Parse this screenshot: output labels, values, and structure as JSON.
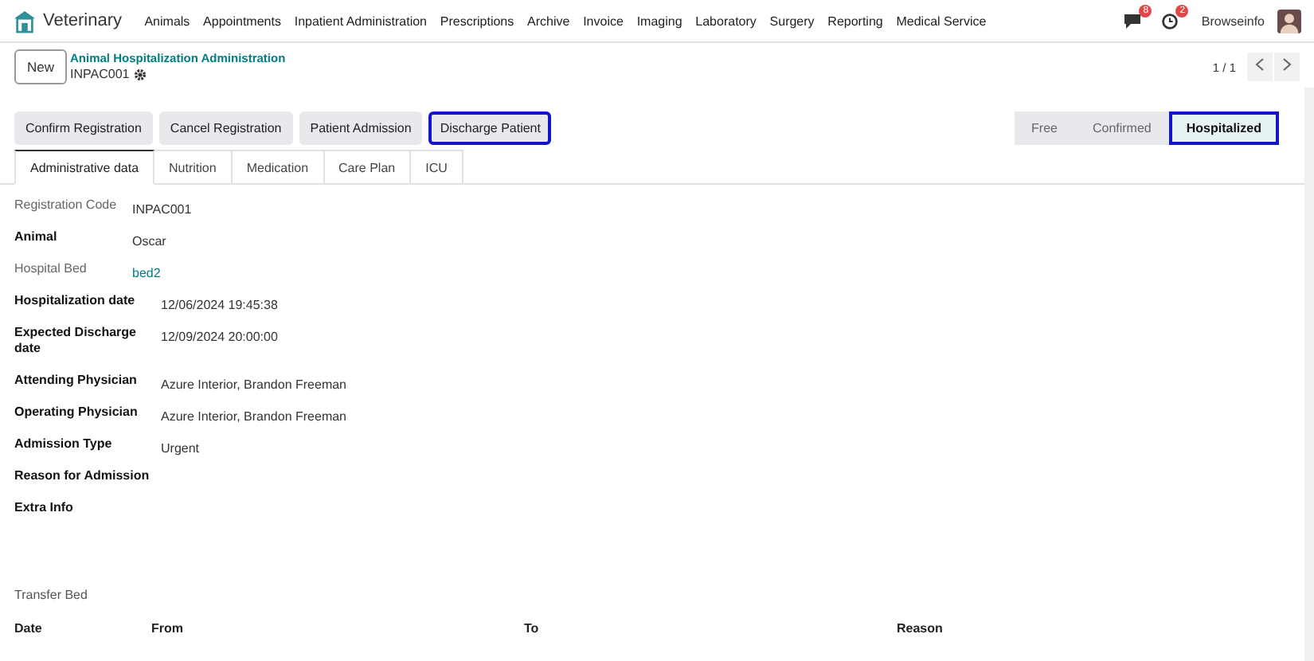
{
  "navbar": {
    "app_name": "Veterinary",
    "menu": [
      "Animals",
      "Appointments",
      "Inpatient Administration",
      "Prescriptions",
      "Archive",
      "Invoice",
      "Imaging",
      "Laboratory",
      "Surgery",
      "Reporting",
      "Medical Service"
    ],
    "messages_badge": "8",
    "activities_badge": "2",
    "user": "Browseinfo"
  },
  "control_panel": {
    "new_button": "New",
    "breadcrumb": "Animal Hospitalization Administration",
    "record": "INPAC001",
    "pager": "1 / 1"
  },
  "actions": [
    {
      "label": "Confirm Registration",
      "highlighted": false
    },
    {
      "label": "Cancel Registration",
      "highlighted": false
    },
    {
      "label": "Patient Admission",
      "highlighted": false
    },
    {
      "label": "Discharge Patient",
      "highlighted": true
    }
  ],
  "statusbar": [
    {
      "label": "Free",
      "selected": false,
      "highlighted": false
    },
    {
      "label": "Confirmed",
      "selected": false,
      "highlighted": false
    },
    {
      "label": "Hospitalized",
      "selected": true,
      "highlighted": true
    }
  ],
  "tabs": [
    {
      "label": "Administrative data",
      "selected": true
    },
    {
      "label": "Nutrition",
      "selected": false
    },
    {
      "label": "Medication",
      "selected": false
    },
    {
      "label": "Care Plan",
      "selected": false
    },
    {
      "label": "ICU",
      "selected": false
    }
  ],
  "field_groups": [
    [
      {
        "label": "Registration Code",
        "required": false,
        "value": "INPAC001",
        "kind": "text"
      },
      {
        "label": "Animal",
        "required": true,
        "value": "Oscar",
        "kind": "text"
      },
      {
        "label": "Hospital Bed",
        "required": false,
        "value": "bed2",
        "kind": "link"
      }
    ],
    [
      {
        "label": "Hospitalization date",
        "required": true,
        "value": "12/06/2024 19:45:38",
        "kind": "text"
      },
      {
        "label": "Expected Discharge date",
        "required": true,
        "value": "12/09/2024 20:00:00",
        "kind": "text"
      },
      {
        "label": "Attending Physician",
        "required": true,
        "value": "Azure Interior, Brandon Freeman",
        "kind": "text"
      },
      {
        "label": "Operating Physician",
        "required": true,
        "value": "Azure Interior, Brandon Freeman",
        "kind": "text"
      },
      {
        "label": "Admission Type",
        "required": true,
        "value": "Urgent",
        "kind": "text"
      },
      {
        "label": "Reason for Admission",
        "required": true
      },
      {
        "label": "Extra Info",
        "required": true
      }
    ]
  ],
  "transfer_bed": {
    "title": "Transfer Bed",
    "columns": [
      "Date",
      "From",
      "To",
      "Reason"
    ]
  }
}
